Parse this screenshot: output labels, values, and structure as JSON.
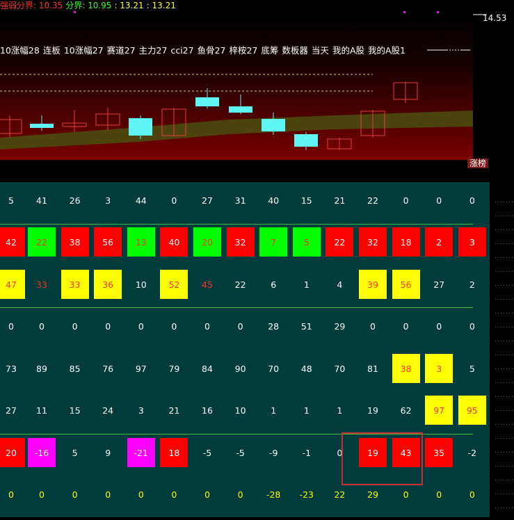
{
  "header": {
    "strength_label": "强弱分界: 10.35",
    "divide_label": "分界: 10.95",
    "time_label": ": 13.21",
    "time_label2": ": 13.21"
  },
  "price_label": "14.53",
  "indicator_tabs": [
    "10涨幅28",
    "连板",
    "10涨幅27",
    "赛道27",
    "主力27",
    "cci27",
    "鱼骨27",
    "梓桉27",
    "底筹",
    "数板器",
    "当天",
    "我的A股",
    "我的A股1"
  ],
  "rank_tab": "涨榜",
  "colors": {
    "red": "#ff0000",
    "green": "#00ff00",
    "yellow": "#ffff00",
    "magenta": "#ff00ff",
    "text_white": "#ffffff",
    "text_red": "#ff3030",
    "text_yellow": "#ffff00",
    "candle_up": "#e04040",
    "candle_down": "#5ff5f5"
  },
  "grid_rows": [
    {
      "cells": [
        [
          "5",
          ""
        ],
        [
          "41",
          ""
        ],
        [
          "26",
          ""
        ],
        [
          "3",
          ""
        ],
        [
          "44",
          ""
        ],
        [
          "0",
          ""
        ],
        [
          "27",
          ""
        ],
        [
          "31",
          ""
        ],
        [
          "40",
          ""
        ],
        [
          "15",
          ""
        ],
        [
          "21",
          ""
        ],
        [
          "22",
          ""
        ],
        [
          "0",
          ""
        ],
        [
          "0",
          ""
        ],
        [
          "0",
          ""
        ]
      ]
    },
    {
      "cells": [
        [
          "42",
          "red"
        ],
        [
          "22",
          "green"
        ],
        [
          "38",
          "red"
        ],
        [
          "56",
          "red"
        ],
        [
          "13",
          "green"
        ],
        [
          "40",
          "red"
        ],
        [
          "20",
          "green"
        ],
        [
          "32",
          "red"
        ],
        [
          "7",
          "green"
        ],
        [
          "5",
          "green"
        ],
        [
          "22",
          "red"
        ],
        [
          "32",
          "red"
        ],
        [
          "18",
          "red"
        ],
        [
          "2",
          "red"
        ],
        [
          "3",
          "red"
        ]
      ]
    },
    {
      "cells": [
        [
          "47",
          "yellow"
        ],
        [
          "33",
          "redtext"
        ],
        [
          "33",
          "yellow"
        ],
        [
          "36",
          "yellow"
        ],
        [
          "10",
          ""
        ],
        [
          "52",
          "yellow"
        ],
        [
          "45",
          "redtext"
        ],
        [
          "22",
          ""
        ],
        [
          "6",
          ""
        ],
        [
          "1",
          ""
        ],
        [
          "4",
          ""
        ],
        [
          "39",
          "yellow"
        ],
        [
          "56",
          "yellow"
        ],
        [
          "27",
          ""
        ],
        [
          "2",
          ""
        ]
      ]
    },
    {
      "cells": [
        [
          "0",
          ""
        ],
        [
          "0",
          ""
        ],
        [
          "0",
          ""
        ],
        [
          "0",
          ""
        ],
        [
          "0",
          ""
        ],
        [
          "0",
          ""
        ],
        [
          "0",
          ""
        ],
        [
          "0",
          ""
        ],
        [
          "28",
          ""
        ],
        [
          "51",
          ""
        ],
        [
          "29",
          ""
        ],
        [
          "0",
          ""
        ],
        [
          "0",
          ""
        ],
        [
          "0",
          ""
        ],
        [
          "0",
          ""
        ]
      ]
    },
    {
      "cells": [
        [
          "73",
          ""
        ],
        [
          "89",
          ""
        ],
        [
          "85",
          ""
        ],
        [
          "76",
          ""
        ],
        [
          "97",
          ""
        ],
        [
          "79",
          ""
        ],
        [
          "84",
          ""
        ],
        [
          "90",
          ""
        ],
        [
          "70",
          ""
        ],
        [
          "48",
          ""
        ],
        [
          "70",
          ""
        ],
        [
          "81",
          ""
        ],
        [
          "38",
          "yellow"
        ],
        [
          "3",
          "yellow"
        ],
        [
          "5",
          ""
        ]
      ]
    },
    {
      "cells": [
        [
          "27",
          ""
        ],
        [
          "11",
          ""
        ],
        [
          "15",
          ""
        ],
        [
          "24",
          ""
        ],
        [
          "3",
          ""
        ],
        [
          "21",
          ""
        ],
        [
          "16",
          ""
        ],
        [
          "10",
          ""
        ],
        [
          "1",
          ""
        ],
        [
          "1",
          ""
        ],
        [
          "1",
          ""
        ],
        [
          "19",
          ""
        ],
        [
          "62",
          ""
        ],
        [
          "97",
          "yellow"
        ],
        [
          "95",
          "yellow"
        ]
      ]
    },
    {
      "cells": [
        [
          "20",
          "red"
        ],
        [
          "-16",
          "magenta"
        ],
        [
          "5",
          ""
        ],
        [
          "9",
          ""
        ],
        [
          "-21",
          "magenta"
        ],
        [
          "18",
          "red"
        ],
        [
          "-5",
          ""
        ],
        [
          "-5",
          ""
        ],
        [
          "-9",
          ""
        ],
        [
          "-1",
          ""
        ],
        [
          "0",
          ""
        ],
        [
          "19",
          "red"
        ],
        [
          "43",
          "red"
        ],
        [
          "35",
          "red"
        ],
        [
          "-2",
          ""
        ]
      ]
    },
    {
      "cells": [
        [
          "0",
          "ytext"
        ],
        [
          "0",
          "ytext"
        ],
        [
          "0",
          "ytext"
        ],
        [
          "0",
          "ytext"
        ],
        [
          "0",
          "ytext"
        ],
        [
          "0",
          "ytext"
        ],
        [
          "0",
          "ytext"
        ],
        [
          "0",
          "ytext"
        ],
        [
          "-28",
          "ytext"
        ],
        [
          "-23",
          "ytext"
        ],
        [
          "22",
          "ytext"
        ],
        [
          "29",
          "ytext"
        ],
        [
          "0",
          "ytext"
        ],
        [
          "0",
          "ytext"
        ],
        [
          "0",
          "ytext"
        ]
      ]
    }
  ]
}
